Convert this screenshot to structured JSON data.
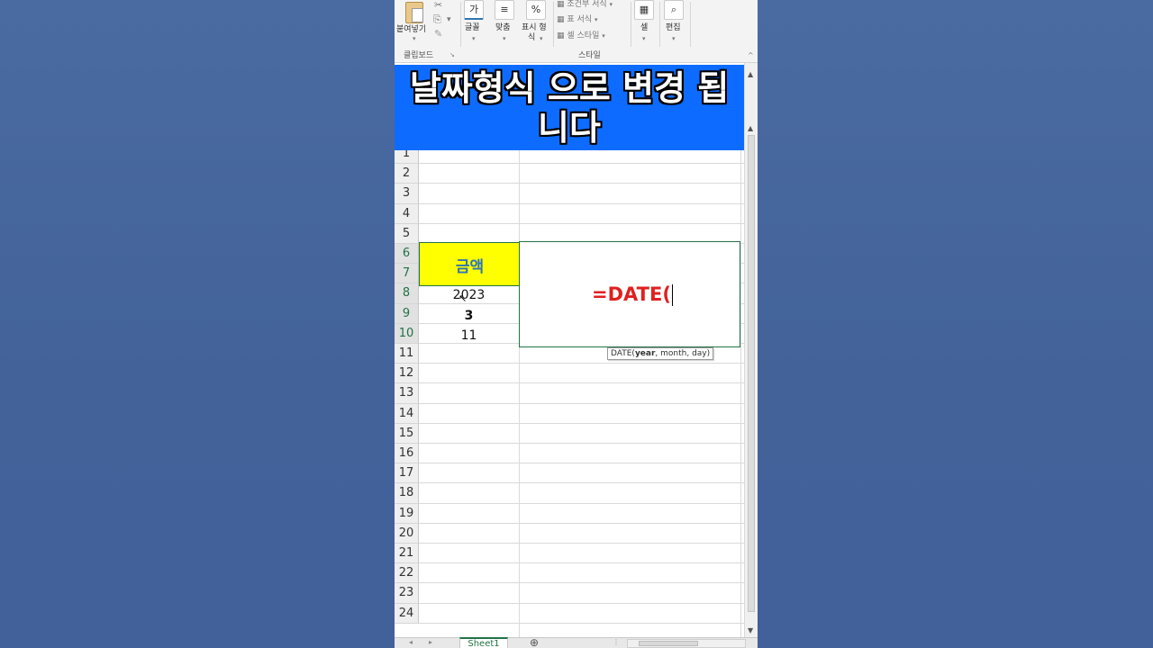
{
  "ribbon": {
    "paste_label": "붙여넣기",
    "clipboard_caption": "클립보드",
    "font_label": "글꼴",
    "font_icon_char": "가",
    "align_label": "맞춤",
    "align_icon_char": "≡",
    "number_label_line1": "표시 형",
    "number_label_line2": "식",
    "number_icon_char": "%",
    "conditional_format": "조건부 서식",
    "table_format": "표 서식",
    "cell_style": "셀 스타일",
    "styles_caption": "스타일",
    "cells_label": "셀",
    "edit_label": "편집"
  },
  "banner": {
    "line1": "날짜형식 으로 변경 됩",
    "line2": "니다"
  },
  "rows": [
    "1",
    "2",
    "3",
    "4",
    "5",
    "6",
    "7",
    "8",
    "9",
    "10",
    "11",
    "12",
    "13",
    "14",
    "15",
    "16",
    "17",
    "18",
    "19",
    "20",
    "21",
    "22",
    "23",
    "24"
  ],
  "cells": {
    "header": "금액",
    "year": "2023",
    "month": "3",
    "day": "11",
    "formula": "=DATE("
  },
  "tooltip": {
    "func": "DATE(",
    "args": "year",
    "rest": ", month, day)"
  },
  "sheetbar": {
    "sheet_name": "Sheet1",
    "add_symbol": "⊕"
  },
  "colors": {
    "banner": "#0d6cff",
    "header_fill": "#ffff00",
    "header_text": "#2f75b5",
    "formula_text": "#e02020",
    "excel_green": "#217346",
    "background": "#43629a"
  }
}
